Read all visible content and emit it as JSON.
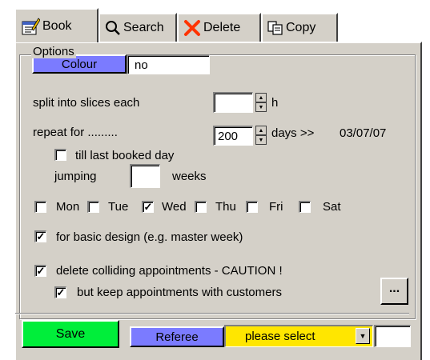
{
  "tabs": [
    {
      "label": "Book",
      "icon": "book-icon"
    },
    {
      "label": "Search",
      "icon": "magnifier-icon"
    },
    {
      "label": "Delete",
      "icon": "delete-x-icon"
    },
    {
      "label": "Copy",
      "icon": "copy-icon"
    }
  ],
  "options": {
    "group_title": "Options",
    "colour_label": "Colour",
    "colour_value": "no",
    "split_label": "split into slices each",
    "split_value": "",
    "split_unit": "h",
    "repeat_label": "repeat for .........",
    "repeat_value": "200",
    "repeat_unit": "days >>",
    "repeat_end_date": "03/07/07",
    "till_last_label": "till last booked day",
    "till_last_checked": false,
    "jumping_label": "jumping",
    "jumping_value": "",
    "jumping_unit": "weeks",
    "weekdays": [
      {
        "label": "Mon",
        "checked": false
      },
      {
        "label": "Tue",
        "checked": false
      },
      {
        "label": "Wed",
        "checked": true
      },
      {
        "label": "Thu",
        "checked": false
      },
      {
        "label": "Fri",
        "checked": false
      },
      {
        "label": "Sat",
        "checked": false
      }
    ],
    "basic_design_label": "for basic design (e.g. master week)",
    "basic_design_checked": true,
    "delete_colliding_label": "delete colliding appointments - CAUTION !",
    "delete_colliding_checked": true,
    "keep_customers_label": "but keep appointments with customers",
    "keep_customers_checked": true,
    "more_button_label": "..."
  },
  "footer": {
    "save_label": "Save",
    "referee_label": "Referee",
    "referee_select_value": "please select",
    "extra_value": ""
  },
  "colors": {
    "panel": "#d4d0c8",
    "save_green": "#00ee3a",
    "button_blue": "#7b7bff",
    "select_yellow": "#ffe600"
  }
}
